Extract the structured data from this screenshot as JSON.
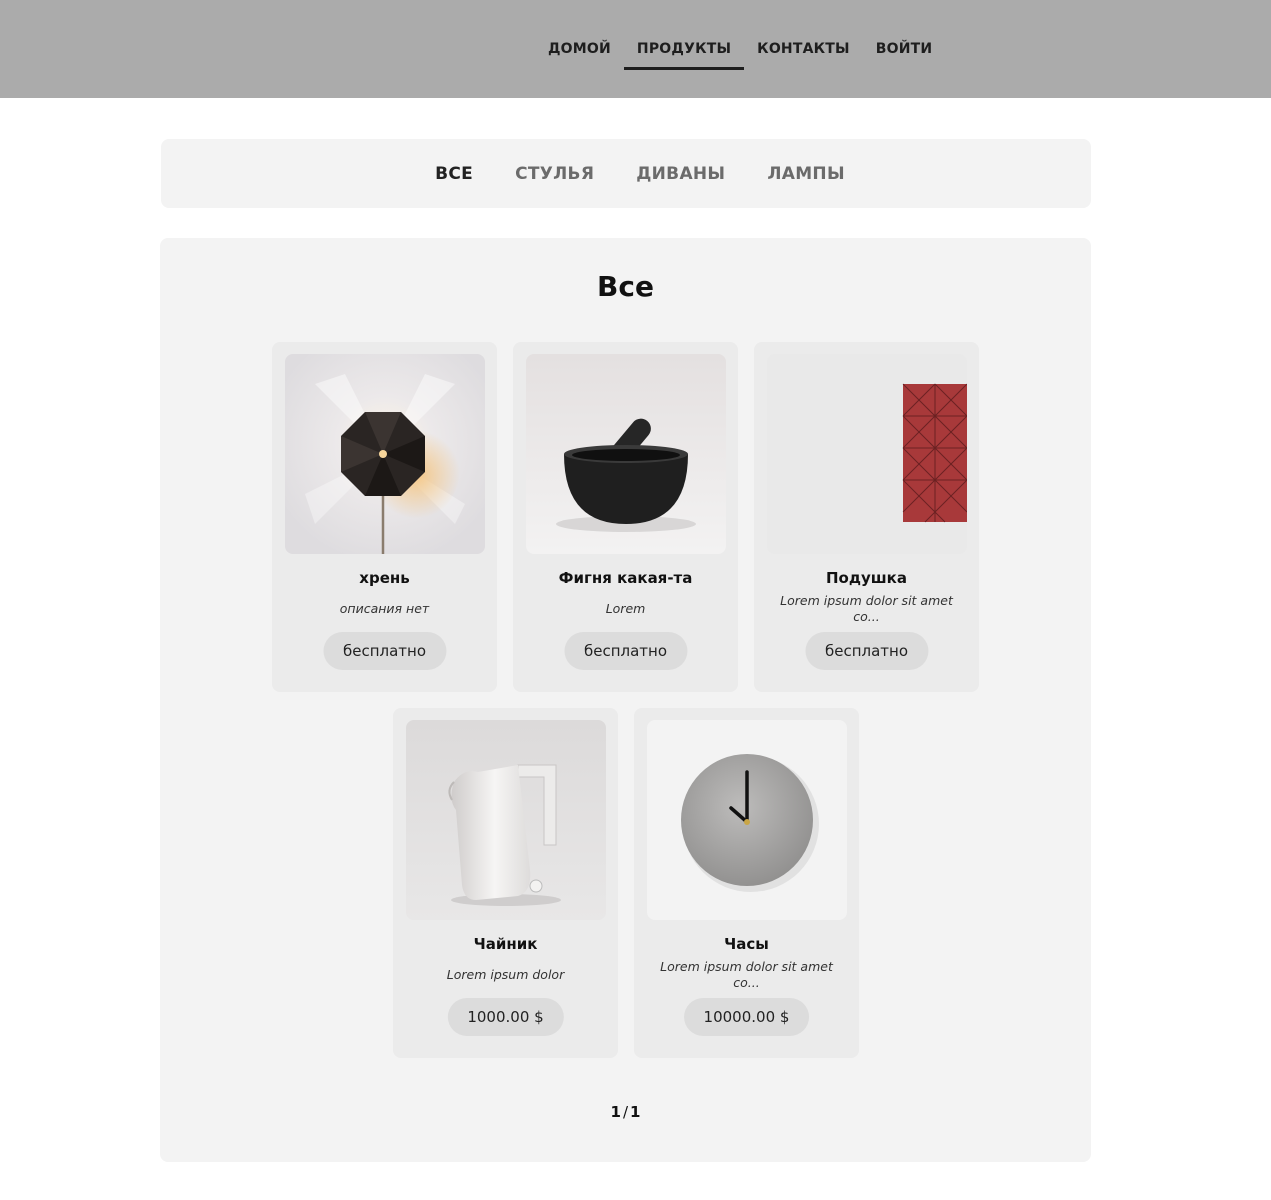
{
  "nav": {
    "items": [
      {
        "label": "ДОМОЙ"
      },
      {
        "label": "ПРОДУКТЫ"
      },
      {
        "label": "КОНТАКТЫ"
      },
      {
        "label": "ВОЙТИ"
      }
    ],
    "active": "ПРОДУКТЫ"
  },
  "categories": {
    "items": [
      {
        "label": "ВСЕ"
      },
      {
        "label": "СТУЛЬЯ"
      },
      {
        "label": "ДИВАНЫ"
      },
      {
        "label": "ЛАМПЫ"
      }
    ],
    "active": "ВСЕ"
  },
  "main": {
    "title": "Все",
    "products": [
      {
        "name": "хрень",
        "description": "описания нет",
        "price": "бесплатно",
        "image": "wall-lamp-image"
      },
      {
        "name": "Фигня какая-та",
        "description": "Lorem",
        "price": "бесплатно",
        "image": "mortar-and-pestle-image"
      },
      {
        "name": "Подушка",
        "description": "Lorem ipsum dolor sit amet co...",
        "price": "бесплатно",
        "image": "red-pillow-image"
      },
      {
        "name": "Чайник",
        "description": "Lorem ipsum dolor",
        "price": "1000.00 $",
        "image": "ceramic-jug-image"
      },
      {
        "name": "Часы",
        "description": "Lorem ipsum dolor sit amet co...",
        "price": "10000.00 $",
        "image": "wall-clock-image"
      }
    ],
    "pagination": {
      "current": "1",
      "separator": "/",
      "total": "1"
    }
  },
  "colors": {
    "header_bg": "#ababab",
    "panel_bg": "#f3f3f3",
    "card_bg": "#ebebeb",
    "price_pill": "#dcdcdc",
    "pillow_red": "#a8393a"
  }
}
